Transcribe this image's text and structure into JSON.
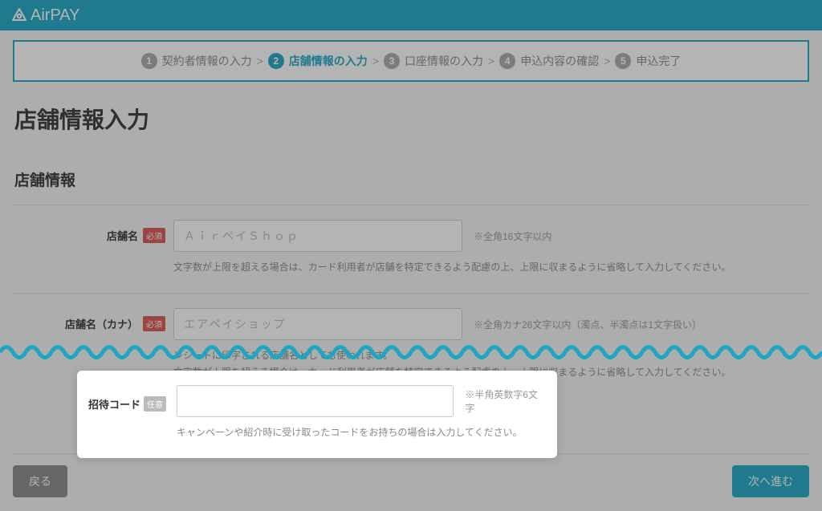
{
  "brand": "AirPAY",
  "stepper": {
    "steps": [
      {
        "num": "1",
        "label": "契約者情報の入力"
      },
      {
        "num": "2",
        "label": "店舗情報の入力"
      },
      {
        "num": "3",
        "label": "口座情報の入力"
      },
      {
        "num": "4",
        "label": "申込内容の確認"
      },
      {
        "num": "5",
        "label": "申込完了"
      }
    ],
    "active_index": 1,
    "separator": ">"
  },
  "page_title": "店舗情報入力",
  "section_title": "店舗情報",
  "fields": {
    "shop_name": {
      "label": "店舗名",
      "badge": "必須",
      "placeholder": "ＡｉｒペイＳｈｏｐ",
      "value": "",
      "note": "※全角16文字以内",
      "help": "文字数が上限を超える場合は、カード利用者が店舗を特定できるよう配慮の上、上限に収まるように省略して入力してください。"
    },
    "shop_name_kana": {
      "label": "店舗名（カナ）",
      "badge": "必須",
      "placeholder": "エアペイショップ",
      "value": "",
      "note": "※全角カナ26文字以内（濁点、半濁点は1文字扱い）",
      "help1": "レシートに印字される店舗名としても使われます。",
      "help2": "文字数が上限を超える場合は、カード利用者が店舗を特定できるよう配慮の上、上限に収まるように省略して入力してください。"
    },
    "invite_code": {
      "label": "招待コード",
      "badge": "任意",
      "placeholder": "",
      "value": "",
      "note": "※半角英数字6文字",
      "help": "キャンペーンや紹介時に受け取ったコードをお持ちの場合は入力してください。"
    }
  },
  "buttons": {
    "back": "戻る",
    "next": "次へ進む"
  }
}
